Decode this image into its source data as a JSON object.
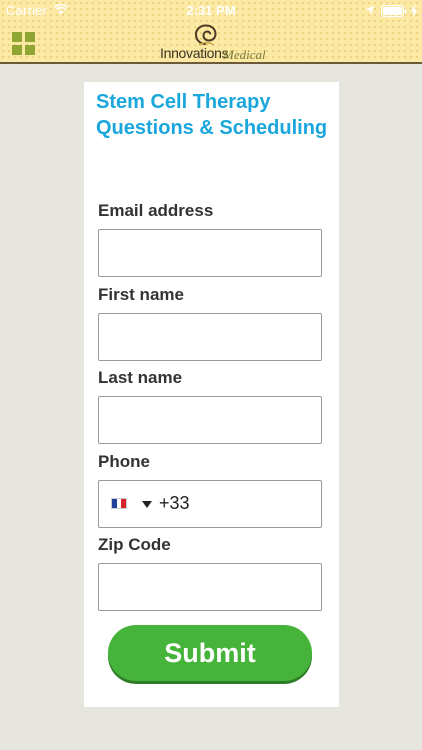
{
  "status_bar": {
    "carrier": "Carrier",
    "time": "2:31 PM",
    "icons": [
      "wifi-icon",
      "location-icon",
      "battery-icon",
      "charging-icon"
    ]
  },
  "header": {
    "menu_icon": "grid-menu-icon",
    "logo_word_1": "Innovations",
    "logo_word_2": "Medical",
    "background_color": "#fbe9a4"
  },
  "form": {
    "title": "Stem Cell Therapy Questions & Scheduling",
    "title_color": "#1aa7dc",
    "fields": {
      "email": {
        "label": "Email address",
        "value": ""
      },
      "first_name": {
        "label": "First name",
        "value": ""
      },
      "last_name": {
        "label": "Last name",
        "value": ""
      },
      "phone": {
        "label": "Phone",
        "country_flag": "france-flag-icon",
        "dial_code": "+33"
      },
      "zip": {
        "label": "Zip Code",
        "value": ""
      }
    },
    "submit_label": "Submit",
    "submit_color": "#46b33a"
  }
}
